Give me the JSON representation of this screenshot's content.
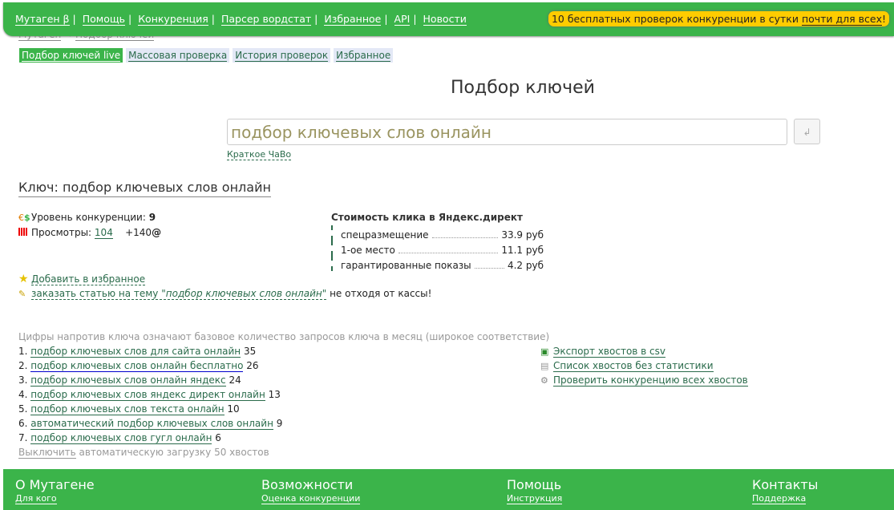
{
  "header": {
    "nav": [
      "Мутаген β",
      "Помощь",
      "Конкуренция",
      "Парсер вордстат",
      "Избранное",
      "API",
      "Новости"
    ],
    "promo_text": "10 бесплатных проверок конкуренции в сутки ",
    "promo_link": "почти для всех",
    "promo_end": "!"
  },
  "breadcrumb": [
    "Мутаген",
    "Подбор ключей"
  ],
  "tabs": [
    "Подбор ключей live",
    "Массовая проверка",
    "История проверок",
    "Избранное"
  ],
  "page_title": "Подбор ключей",
  "search": {
    "value": "подбор ключевых слов онлайн",
    "enter_icon": "↲",
    "faq": "Краткое ЧаВо"
  },
  "key": {
    "heading": "Ключ: подбор ключевых слов онлайн",
    "competition_label": "Уровень конкуренции: ",
    "competition_value": "9",
    "views_label": "Просмотры: ",
    "views_value": "104",
    "views_extra": "+140"
  },
  "cost": {
    "title": "Стоимость клика в Яндекс.директ",
    "rows": [
      {
        "label": "спецразмещение",
        "value": "33.9 руб"
      },
      {
        "label": "1-ое место",
        "value": "11.1 руб"
      },
      {
        "label": "гарантированные показы",
        "value": "4.2 руб"
      }
    ]
  },
  "actions": {
    "favorite": "Добавить в избранное",
    "order_prefix": "заказать статью на тему \"",
    "order_topic": "подбор ключевых слов онлайн",
    "order_quote": "\"",
    "order_suffix": " не отходя от кассы!"
  },
  "tails": {
    "hint": "Цифры напротив ключа означают базовое количество запросов ключа в месяц (широкое соответствие)",
    "items": [
      {
        "n": "1. ",
        "text": "подбор ключевых слов для сайта онлайн",
        "count": " 35"
      },
      {
        "n": "2. ",
        "text": "подбор ключевых слов онлайн бесплатно",
        "count": " 26"
      },
      {
        "n": "3. ",
        "text": "подбор ключевых слов онлайн яндекс",
        "count": " 24"
      },
      {
        "n": "4. ",
        "text": "подбор ключевых слов яндекс директ онлайн",
        "count": " 13"
      },
      {
        "n": "5. ",
        "text": "подбор ключевых слов текста онлайн",
        "count": " 10"
      },
      {
        "n": "6. ",
        "text": "автоматический подбор ключевых слов онлайн",
        "count": " 9"
      },
      {
        "n": "7. ",
        "text": "подбор ключевых слов гугл онлайн",
        "count": " 6"
      }
    ],
    "off_link": "Выключить",
    "off_text": " автоматическую загрузку 50 хвостов",
    "tools": [
      "Экспорт хвостов в csv",
      "Список хвостов без статистики",
      "Проверить конкуренцию всех хвостов"
    ]
  },
  "footer": [
    {
      "title": "О Мутагене",
      "link": "Для кого"
    },
    {
      "title": "Возможности",
      "link": "Оценка конкуренции"
    },
    {
      "title": "Помощь",
      "link": "Инструкция"
    },
    {
      "title": "Контакты",
      "link": "Поддержка"
    }
  ],
  "colors": {
    "brand_green": "#3bb44a",
    "promo_yellow": "#ffcc00",
    "link": "#2a6b4b"
  }
}
